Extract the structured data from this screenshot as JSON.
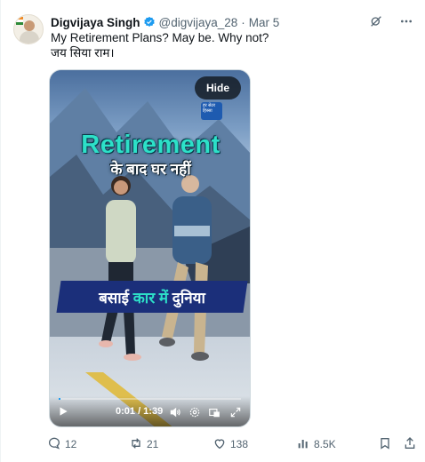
{
  "author": {
    "name": "Digvijaya Singh",
    "handle": "@digvijaya_28",
    "separator": "·",
    "date": "Mar 5",
    "verified": true
  },
  "tweet": {
    "line1": "My Retirement Plans? May be.  Why not?",
    "line2": "जय सिया राम।"
  },
  "media": {
    "hide_label": "Hide",
    "logo_text": "हर सेटर हिस्सा",
    "title": "Retirement",
    "subtitle": "के बाद घर नहीं",
    "band_part1": "बसाई ",
    "band_highlight": "कार में",
    "band_part2": " दुनिया",
    "time": "0:01 / 1:39",
    "progress": 0.01
  },
  "actions": {
    "replies": "12",
    "reposts": "21",
    "likes": "138",
    "views": "8.5K"
  },
  "icons": {
    "top": [
      "grok-icon",
      "more-icon"
    ],
    "actions": [
      "reply-icon",
      "repost-icon",
      "like-icon",
      "views-icon",
      "bookmark-icon",
      "share-icon"
    ]
  },
  "colors": {
    "accent": "#1d9bf0",
    "text": "#0f1419",
    "muted": "#536471",
    "title_teal": "#2de0c8"
  }
}
